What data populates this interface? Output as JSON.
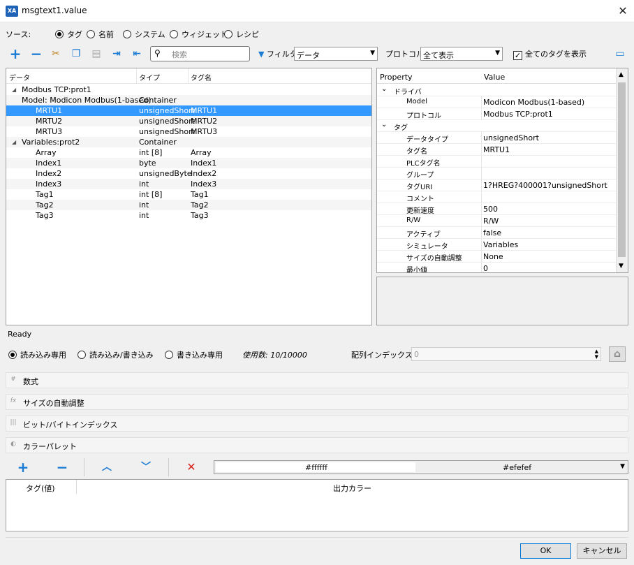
{
  "window": {
    "title": "msgtext1.value",
    "icon_text": "XA",
    "close": "✕"
  },
  "source": {
    "label": "ソース:",
    "options": [
      "タグ",
      "名前",
      "システム",
      "ウィジェット",
      "レシピ"
    ],
    "selected": 0
  },
  "toolbar": {
    "search_placeholder": "検索",
    "filter_label": "フィルタ",
    "filter_value": "データ",
    "protocol_label": "プロトコル:",
    "protocol_value": "全て表示",
    "show_all_label": "全てのタグを表示",
    "show_all_checked": true
  },
  "tree": {
    "columns": [
      "データ",
      "タイプ",
      "タグ名"
    ],
    "rows": [
      {
        "name": "Modbus TCP:prot1",
        "type": "",
        "tag": "",
        "level": 0,
        "expand": true
      },
      {
        "name": "Model: Modicon Modbus(1-based)",
        "type": "Container",
        "tag": "",
        "level": 0,
        "expand": false
      },
      {
        "name": "MRTU1",
        "type": "unsignedShort",
        "tag": "MRTU1",
        "level": 1,
        "selected": true
      },
      {
        "name": "MRTU2",
        "type": "unsignedShort",
        "tag": "MRTU2",
        "level": 1
      },
      {
        "name": "MRTU3",
        "type": "unsignedShort",
        "tag": "MRTU3",
        "level": 1
      },
      {
        "name": "Variables:prot2",
        "type": "Container",
        "tag": "",
        "level": 0,
        "expand": true
      },
      {
        "name": "Array",
        "type": "int [8]",
        "tag": "Array",
        "level": 1
      },
      {
        "name": "Index1",
        "type": "byte",
        "tag": "Index1",
        "level": 1
      },
      {
        "name": "Index2",
        "type": "unsignedByte",
        "tag": "Index2",
        "level": 1
      },
      {
        "name": "Index3",
        "type": "int",
        "tag": "Index3",
        "level": 1
      },
      {
        "name": "Tag1",
        "type": "int [8]",
        "tag": "Tag1",
        "level": 1
      },
      {
        "name": "Tag2",
        "type": "int",
        "tag": "Tag2",
        "level": 1
      },
      {
        "name": "Tag3",
        "type": "int",
        "tag": "Tag3",
        "level": 1
      }
    ]
  },
  "properties": {
    "columns": [
      "Property",
      "Value"
    ],
    "rows": [
      {
        "cat": true,
        "k": "ドライバ",
        "v": ""
      },
      {
        "k": "Model",
        "v": "Modicon Modbus(1-based)"
      },
      {
        "k": "プロトコル",
        "v": "Modbus TCP:prot1"
      },
      {
        "cat": true,
        "k": "タグ",
        "v": ""
      },
      {
        "k": "データタイプ",
        "v": "unsignedShort"
      },
      {
        "k": "タグ名",
        "v": "MRTU1"
      },
      {
        "k": "PLCタグ名",
        "v": ""
      },
      {
        "k": "グループ",
        "v": ""
      },
      {
        "k": "タグURI",
        "v": "1?HREG?400001?unsignedShort"
      },
      {
        "k": "コメント",
        "v": ""
      },
      {
        "k": "更新速度",
        "v": "500"
      },
      {
        "k": "R/W",
        "v": "R/W"
      },
      {
        "k": "アクティブ",
        "v": "false"
      },
      {
        "k": "シミュレータ",
        "v": "Variables"
      },
      {
        "k": "サイズの自動調整",
        "v": "None"
      },
      {
        "k": "最小値",
        "v": "0"
      }
    ]
  },
  "status": "Ready",
  "access": {
    "options": [
      "読み込み専用",
      "読み込み/書き込み",
      "書き込み専用"
    ],
    "selected": 0,
    "usage": "使用数:  10/10000",
    "array_index_label": "配列インデックス:",
    "array_index_value": "0"
  },
  "sections": [
    {
      "icon": "#",
      "label": "数式"
    },
    {
      "icon": "fx",
      "label": "サイズの自動調整"
    },
    {
      "icon": "|||",
      "label": "ビット/バイトインデックス"
    },
    {
      "icon": "◐",
      "label": "カラーパレット"
    }
  ],
  "palette": {
    "color1": "#ffffff",
    "color2": "#efefef",
    "columns": [
      "タグ(値)",
      "出力カラー"
    ]
  },
  "buttons": {
    "ok": "OK",
    "cancel": "キャンセル"
  }
}
